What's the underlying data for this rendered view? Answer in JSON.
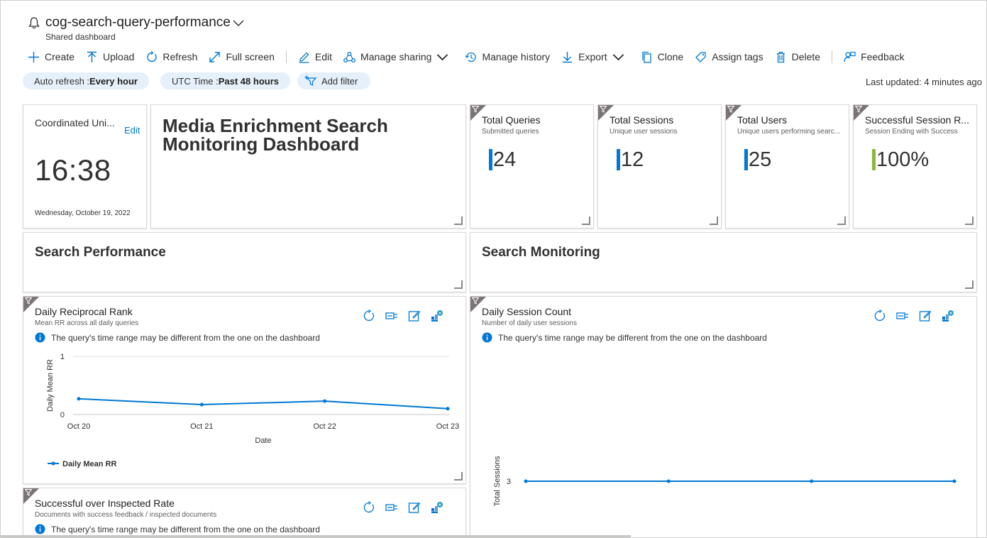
{
  "header": {
    "title": "cog-search-query-performance",
    "subtitle": "Shared dashboard",
    "icon": "bell-icon"
  },
  "toolbar": {
    "create": "Create",
    "upload": "Upload",
    "refresh": "Refresh",
    "fullscreen": "Full screen",
    "edit": "Edit",
    "manage_sharing": "Manage sharing",
    "manage_history": "Manage history",
    "export": "Export",
    "clone": "Clone",
    "assign_tags": "Assign tags",
    "delete": "Delete",
    "feedback": "Feedback"
  },
  "filters": {
    "auto_refresh_label": "Auto refresh : ",
    "auto_refresh_value": "Every hour",
    "utc_label": "UTC Time : ",
    "utc_value": "Past 48 hours",
    "add_filter": "Add filter",
    "last_updated": "Last updated: 4 minutes ago"
  },
  "clock": {
    "label": "Coordinated Uni...",
    "edit": "Edit",
    "time": "16:38",
    "date": "Wednesday, October 19, 2022"
  },
  "markdown": {
    "title": "Media Enrichment Search Monitoring Dashboard"
  },
  "kpis": [
    {
      "title": "Total Queries",
      "subtitle": "Submitted queries",
      "value": "24",
      "color": "#0078d4"
    },
    {
      "title": "Total Sessions",
      "subtitle": "Unique user sessions",
      "value": "12",
      "color": "#0078d4"
    },
    {
      "title": "Total Users",
      "subtitle": "Unique users performing searc...",
      "value": "25",
      "color": "#0078d4"
    },
    {
      "title": "Successful Session R...",
      "subtitle": "Session Ending with Success",
      "value": "100%",
      "color": "#8cb63c"
    }
  ],
  "sections": {
    "performance": "Search Performance",
    "monitoring": "Search Monitoring"
  },
  "info_note": "The query's time range may be different from the one on the dashboard",
  "charts": {
    "reciprocal": {
      "title": "Daily Reciprocal Rank",
      "subtitle": "Mean RR across all daily queries"
    },
    "sessions": {
      "title": "Daily Session Count",
      "subtitle": "Number of daily user sessions"
    },
    "inspected": {
      "title": "Successful over Inspected Rate",
      "subtitle": "Documents with success feedback / inspected documents"
    }
  },
  "chart_data": [
    {
      "type": "line",
      "x": [
        "Oct 20",
        "Oct 21",
        "Oct 22",
        "Oct 23"
      ],
      "series": [
        {
          "name": "Daily Mean RR",
          "values": [
            0.27,
            0.17,
            0.23,
            0.1
          ]
        }
      ],
      "xlabel": "Date",
      "ylabel": "Daily Mean RR",
      "ylim": [
        0,
        1
      ],
      "yticks": [
        "0",
        "1"
      ],
      "color": "#0078d4",
      "legend": "bottom-left"
    },
    {
      "type": "line",
      "x": [
        "",
        "",
        "",
        ""
      ],
      "series": [
        {
          "values": [
            3,
            3,
            3,
            3
          ]
        }
      ],
      "ylabel": "Total Sessions",
      "yticks": [
        "3"
      ],
      "color": "#0078d4"
    }
  ]
}
